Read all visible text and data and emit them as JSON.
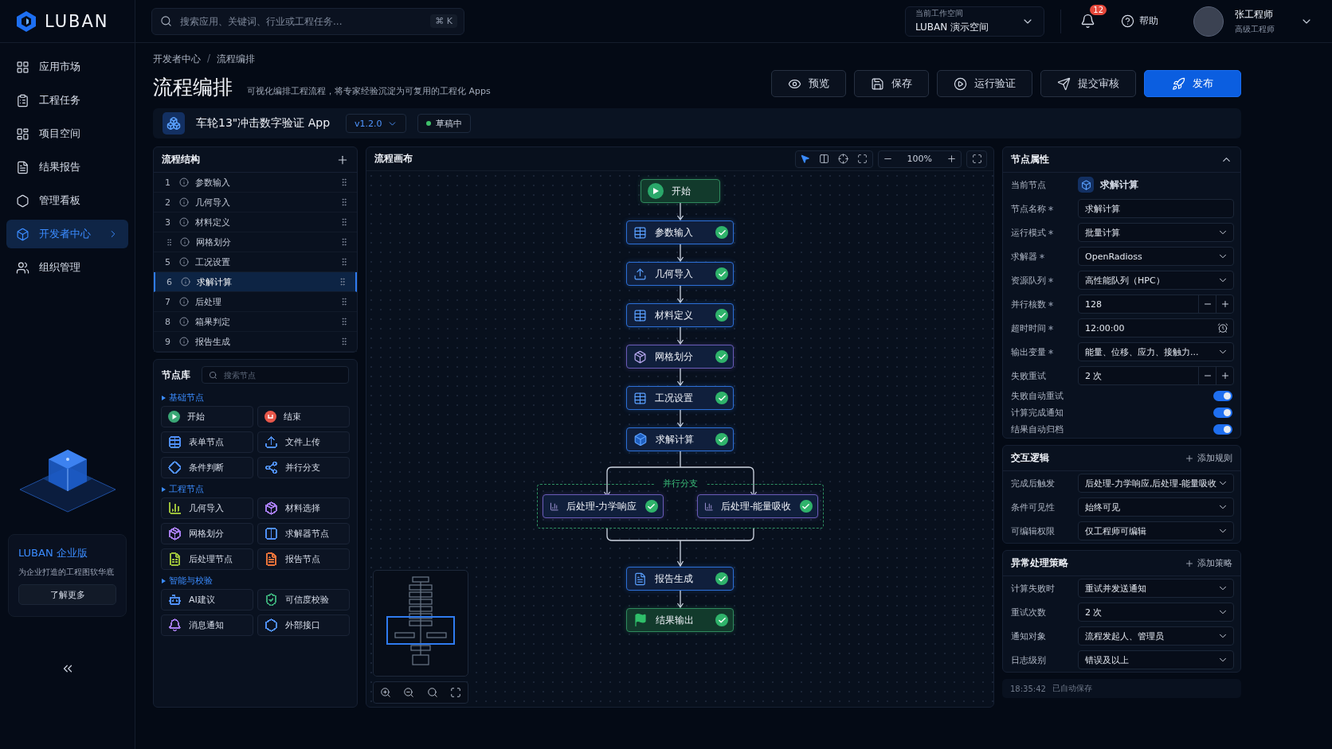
{
  "brand": {
    "name": "LUBAN"
  },
  "search": {
    "placeholder": "搜索应用、关键词、行业或工程任务...",
    "shortcut": "⌘ K"
  },
  "workspace": {
    "label": "当前工作空间",
    "value": "LUBAN 演示空间"
  },
  "notifications": {
    "count": "12"
  },
  "help": {
    "label": "帮助"
  },
  "user": {
    "name": "张工程师",
    "role": "高级工程师"
  },
  "nav": [
    {
      "label": "应用市场",
      "selected": false
    },
    {
      "label": "工程任务",
      "selected": false
    },
    {
      "label": "项目空间",
      "selected": false
    },
    {
      "label": "结果报告",
      "selected": false
    },
    {
      "label": "管理看板",
      "selected": false
    },
    {
      "label": "开发者中心",
      "selected": true
    },
    {
      "label": "组织管理",
      "selected": false
    }
  ],
  "promo": {
    "title": "LUBAN 企业版",
    "text": "为企业打造的工程图软华底",
    "button": "了解更多"
  },
  "breadcrumb": {
    "items": [
      "开发者中心",
      "流程编排"
    ],
    "separator": "/"
  },
  "page": {
    "title": "流程编排",
    "subtitle": "可视化编排工程流程，将专家经验沉淀为可复用的工程化 Apps"
  },
  "actions": [
    {
      "label": "预览",
      "kind": "preview",
      "primary": false
    },
    {
      "label": "保存",
      "kind": "save",
      "primary": false
    },
    {
      "label": "运行验证",
      "kind": "run",
      "primary": false
    },
    {
      "label": "提交审核",
      "kind": "submit",
      "primary": false
    },
    {
      "label": "发布",
      "kind": "publish",
      "primary": true
    }
  ],
  "app": {
    "name": "车轮13\"冲击数字验证 App",
    "version": "v1.2.0",
    "status": "草稿中"
  },
  "structure": {
    "title": "流程结构",
    "items": [
      {
        "index": "1",
        "label": "参数输入",
        "selected": false,
        "dragging": false
      },
      {
        "index": "2",
        "label": "几何导入",
        "selected": false,
        "dragging": false
      },
      {
        "index": "3",
        "label": "材料定义",
        "selected": false,
        "dragging": false
      },
      {
        "label": "网格划分",
        "selected": false,
        "dragging": true
      },
      {
        "index": "5",
        "label": "工况设置",
        "selected": false,
        "dragging": false
      },
      {
        "index": "6",
        "label": "求解计算",
        "selected": true,
        "dragging": false
      },
      {
        "index": "7",
        "label": "后处理",
        "selected": false,
        "dragging": false
      },
      {
        "index": "8",
        "label": "箱果判定",
        "selected": false,
        "dragging": false
      },
      {
        "index": "9",
        "label": "报告生成",
        "selected": false,
        "dragging": false
      }
    ]
  },
  "library": {
    "title": "节点库",
    "placeholder": "搜索节点",
    "sections": [
      {
        "title": "基础节点",
        "items": [
          {
            "label": "开始",
            "kind": "start",
            "color": "#3aa776"
          },
          {
            "label": "结束",
            "kind": "end",
            "color": "#e8574a"
          },
          {
            "label": "表单节点",
            "kind": "form",
            "color": "#4f8ff7"
          },
          {
            "label": "文件上传",
            "kind": "upload",
            "color": "#4f8ff7"
          },
          {
            "label": "条件判断",
            "kind": "condition",
            "color": "#4f8ff7"
          },
          {
            "label": "并行分支",
            "kind": "branch",
            "color": "#4f8ff7"
          }
        ]
      },
      {
        "title": "工程节点",
        "items": [
          {
            "label": "几何导入",
            "kind": "geometry",
            "color": "#9bbf3a"
          },
          {
            "label": "材料选择",
            "kind": "material",
            "color": "#a57cf0"
          },
          {
            "label": "网格划分",
            "kind": "mesh",
            "color": "#a57cf0"
          },
          {
            "label": "求解器节点",
            "kind": "solver",
            "color": "#4f8ff7"
          },
          {
            "label": "后处理节点",
            "kind": "post",
            "color": "#9bbf3a"
          },
          {
            "label": "报告节点",
            "kind": "report",
            "color": "#e8733a"
          }
        ]
      },
      {
        "title": "智能与校验",
        "items": [
          {
            "label": "AI建议",
            "kind": "ai",
            "color": "#4f8ff7"
          },
          {
            "label": "可信度校验",
            "kind": "verify",
            "color": "#3aa776"
          },
          {
            "label": "消息通知",
            "kind": "notify",
            "color": "#a57cf0"
          },
          {
            "label": "外部接口",
            "kind": "api",
            "color": "#4f8ff7"
          }
        ]
      }
    ]
  },
  "canvas": {
    "title": "流程画布",
    "zoom": "100%",
    "nodes": [
      {
        "kind": "start",
        "label": "开始",
        "color": "#2f8a5e",
        "done": false
      },
      {
        "kind": "form",
        "label": "参数输入",
        "color": "#2c6fd6",
        "done": true
      },
      {
        "kind": "upload",
        "label": "几何导入",
        "color": "#2c6fd6",
        "done": true
      },
      {
        "kind": "form",
        "label": "材料定义",
        "color": "#2c6fd6",
        "done": true
      },
      {
        "kind": "mesh",
        "label": "网格划分",
        "color": "#6a5bb8",
        "done": true
      },
      {
        "kind": "form",
        "label": "工况设置",
        "color": "#2c6fd6",
        "done": true
      },
      {
        "kind": "solver",
        "label": "求解计算",
        "color": "#2c6fd6",
        "done": true
      },
      {
        "kind": "branch",
        "label": "并行分支",
        "children": [
          {
            "kind": "chart",
            "label": "后处理-力学响应",
            "color": "#6a5bb8",
            "done": true
          },
          {
            "kind": "chart",
            "label": "后处理-能量吸收",
            "color": "#6a5bb8",
            "done": true
          }
        ]
      },
      {
        "kind": "report",
        "label": "报告生成",
        "color": "#2c6fd6",
        "done": true
      },
      {
        "kind": "end",
        "label": "结果输出",
        "color": "#2f8a5e",
        "done": true
      }
    ]
  },
  "properties": {
    "title": "节点属性",
    "current_label": "当前节点",
    "current_value": "求解计算",
    "fields": [
      {
        "label": "节点名称",
        "required": true,
        "kind": "text",
        "value": "求解计算"
      },
      {
        "label": "运行模式",
        "required": true,
        "kind": "select",
        "value": "批量计算"
      },
      {
        "label": "求解器",
        "required": true,
        "kind": "select",
        "value": "OpenRadioss"
      },
      {
        "label": "资源队列",
        "required": true,
        "kind": "select",
        "value": "高性能队列（HPC）"
      },
      {
        "label": "并行核数",
        "required": true,
        "kind": "stepper",
        "value": "128"
      },
      {
        "label": "超时时间",
        "required": true,
        "kind": "time",
        "value": "12:00:00"
      },
      {
        "label": "输出变量",
        "required": true,
        "kind": "select",
        "value": "能量、位移、应力、接触力..."
      },
      {
        "label": "失败重试",
        "required": false,
        "kind": "stepper",
        "value": "2  次"
      }
    ],
    "toggles": [
      {
        "label": "失败自动重试",
        "on": true
      },
      {
        "label": "计算完成通知",
        "on": true
      },
      {
        "label": "结果自动归档",
        "on": true
      }
    ]
  },
  "interaction": {
    "title": "交互逻辑",
    "add": "添加规则",
    "fields": [
      {
        "label": "完成后触发",
        "value": "后处理-力学响应,后处理-能量吸收"
      },
      {
        "label": "条件可见性",
        "value": "始终可见"
      },
      {
        "label": "可编辑权限",
        "value": "仅工程师可编辑"
      }
    ]
  },
  "exception": {
    "title": "异常处理策略",
    "add": "添加策略",
    "fields": [
      {
        "label": "计算失败时",
        "value": "重试并发送通知"
      },
      {
        "label": "重试次数",
        "value": "2  次"
      },
      {
        "label": "通知对象",
        "value": "流程发起人、管理员"
      },
      {
        "label": "日志级别",
        "value": "错误及以上"
      }
    ]
  },
  "autosave": {
    "time": "18:35:42",
    "text": "已自动保存"
  }
}
